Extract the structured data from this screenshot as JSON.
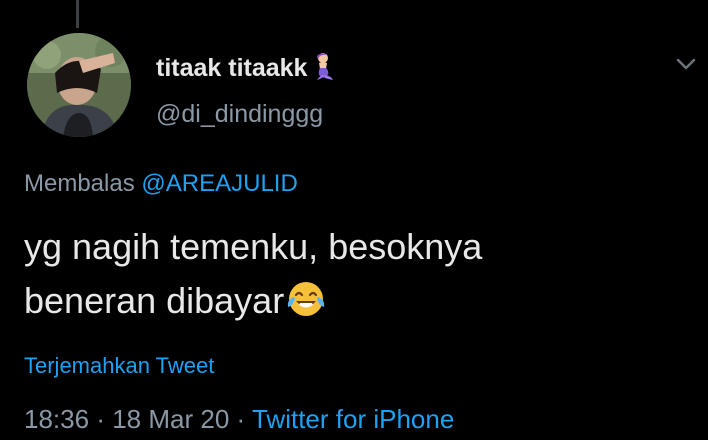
{
  "tweet": {
    "display_name": "titaak titaakk",
    "handle": "@di_dindinggg",
    "reply_prefix": "Membalas",
    "reply_to": "@AREAJULID",
    "text_line1": "yg nagih temenku, besoknya",
    "text_line2": "beneran dibayar",
    "translate_label": "Terjemahkan Tweet",
    "time": "18:36",
    "separator": "·",
    "date": "18 Mar 20",
    "source": "Twitter for iPhone"
  },
  "icons": {
    "name_emoji": "mermaid-emoji",
    "text_emoji": "face-with-tears-of-joy-emoji",
    "menu": "chevron-down-icon"
  },
  "colors": {
    "background": "#000000",
    "primary_text": "#e8e8e8",
    "secondary_text": "#8b98a5",
    "link": "#1da1f2"
  }
}
